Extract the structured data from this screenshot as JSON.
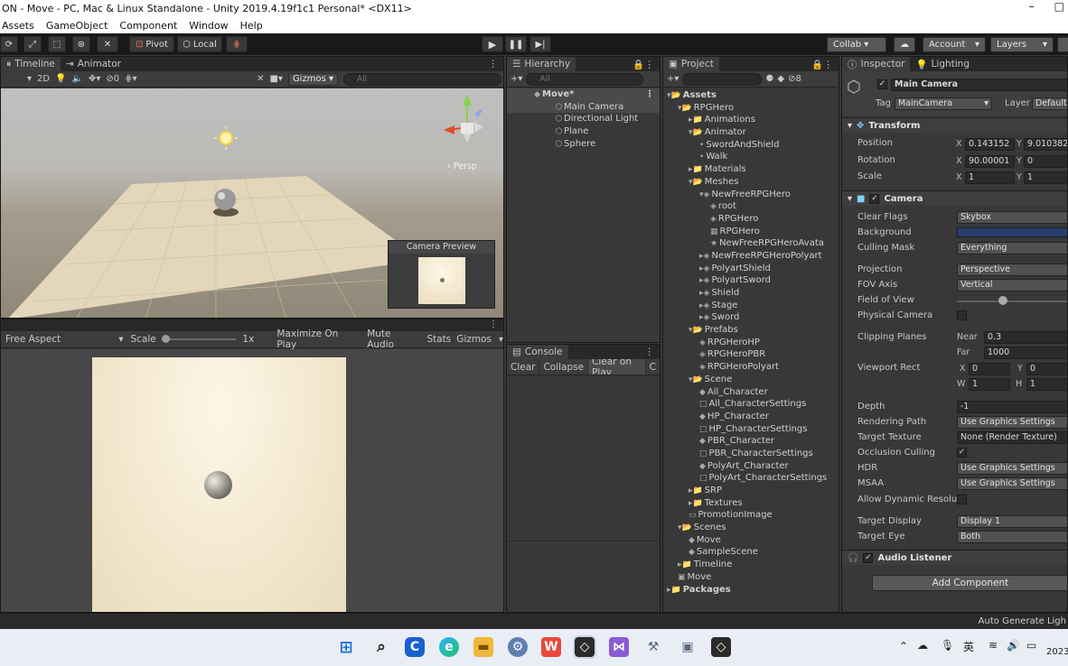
{
  "window": {
    "title": "ON - Move - PC, Mac & Linux Standalone - Unity 2019.4.19f1c1 Personal* <DX11>",
    "minimize": "–",
    "maximize": "□"
  },
  "menu": [
    "Assets",
    "GameObject",
    "Component",
    "Window",
    "Help"
  ],
  "toolbar": {
    "pivot": "Pivot",
    "local": "Local",
    "collab": "Collab ▾",
    "account": "Account",
    "layers": "Layers"
  },
  "scene": {
    "tabs": [
      "Timeline",
      "Animator"
    ],
    "mode2d": "2D",
    "gizmos": "Gizmos",
    "search_placeholder": "All",
    "persp": "‹ Persp",
    "fx_count": "0",
    "camera_preview_title": "Camera Preview"
  },
  "game": {
    "aspect": "Free Aspect",
    "scale_label": "Scale",
    "scale_value": "1x",
    "buttons": [
      "Maximize On Play",
      "Mute Audio",
      "Stats",
      "Gizmos"
    ]
  },
  "hierarchy": {
    "tab": "Hierarchy",
    "search_placeholder": "All",
    "scene": "Move*",
    "items": [
      "Main Camera",
      "Directional Light",
      "Plane",
      "Sphere"
    ]
  },
  "console": {
    "tab": "Console",
    "buttons": [
      "Clear",
      "Collapse",
      "Clear on Play",
      "C"
    ]
  },
  "project": {
    "tab": "Project",
    "badge": "8",
    "tree": [
      {
        "d": 0,
        "t": "Assets",
        "i": "▾📂"
      },
      {
        "d": 1,
        "t": "RPGHero",
        "i": "▾📂"
      },
      {
        "d": 2,
        "t": "Animations",
        "i": "▸📁"
      },
      {
        "d": 2,
        "t": "Animator",
        "i": "▾📂"
      },
      {
        "d": 3,
        "t": "SwordAndShield",
        "i": "•"
      },
      {
        "d": 3,
        "t": "Walk",
        "i": "•"
      },
      {
        "d": 2,
        "t": "Materials",
        "i": "▸📁"
      },
      {
        "d": 2,
        "t": "Meshes",
        "i": "▾📂"
      },
      {
        "d": 3,
        "t": "NewFreeRPGHero",
        "i": "▾◈"
      },
      {
        "d": 4,
        "t": "root",
        "i": "◈"
      },
      {
        "d": 4,
        "t": "RPGHero",
        "i": "◈"
      },
      {
        "d": 4,
        "t": "RPGHero",
        "i": "▦"
      },
      {
        "d": 4,
        "t": "NewFreeRPGHeroAvata",
        "i": "★"
      },
      {
        "d": 3,
        "t": "NewFreeRPGHeroPolyart",
        "i": "▸◈"
      },
      {
        "d": 3,
        "t": "PolyartShield",
        "i": "▸◈"
      },
      {
        "d": 3,
        "t": "PolyartSword",
        "i": "▸◈"
      },
      {
        "d": 3,
        "t": "Shield",
        "i": "▸◈"
      },
      {
        "d": 3,
        "t": "Stage",
        "i": "▸◈"
      },
      {
        "d": 3,
        "t": "Sword",
        "i": "▸◈"
      },
      {
        "d": 2,
        "t": "Prefabs",
        "i": "▾📂"
      },
      {
        "d": 3,
        "t": "RPGHeroHP",
        "i": "◈"
      },
      {
        "d": 3,
        "t": "RPGHeroPBR",
        "i": "◈"
      },
      {
        "d": 3,
        "t": "RPGHeroPolyart",
        "i": "◈"
      },
      {
        "d": 2,
        "t": "Scene",
        "i": "▾📂"
      },
      {
        "d": 3,
        "t": "All_Character",
        "i": "◆"
      },
      {
        "d": 3,
        "t": "All_CharacterSettings",
        "i": "□"
      },
      {
        "d": 3,
        "t": "HP_Character",
        "i": "◆"
      },
      {
        "d": 3,
        "t": "HP_CharacterSettings",
        "i": "□"
      },
      {
        "d": 3,
        "t": "PBR_Character",
        "i": "◆"
      },
      {
        "d": 3,
        "t": "PBR_CharacterSettings",
        "i": "□"
      },
      {
        "d": 3,
        "t": "PolyArt_Character",
        "i": "◆"
      },
      {
        "d": 3,
        "t": "PolyArt_CharacterSettings",
        "i": "□"
      },
      {
        "d": 2,
        "t": "SRP",
        "i": "▸📁"
      },
      {
        "d": 2,
        "t": "Textures",
        "i": "▸📁"
      },
      {
        "d": 2,
        "t": "PromotionImage",
        "i": "▭"
      },
      {
        "d": 1,
        "t": "Scenes",
        "i": "▾📂"
      },
      {
        "d": 2,
        "t": "Move",
        "i": "◆"
      },
      {
        "d": 2,
        "t": "SampleScene",
        "i": "◆"
      },
      {
        "d": 1,
        "t": "Timeline",
        "i": "▸📁"
      },
      {
        "d": 1,
        "t": "Move",
        "i": "▣"
      },
      {
        "d": 0,
        "t": "Packages",
        "i": "▸📁"
      }
    ]
  },
  "inspector": {
    "tabs": [
      "Inspector",
      "Lighting"
    ],
    "object_name": "Main Camera",
    "tag_label": "Tag",
    "tag": "MainCamera",
    "layer_label": "Layer",
    "layer": "Default",
    "transform": {
      "title": "Transform",
      "position_label": "Position",
      "pos_x": "0.143152",
      "pos_y": "9.010382",
      "rotation_label": "Rotation",
      "rot_x": "90.00001",
      "rot_y": "0",
      "scale_label": "Scale",
      "scale_x": "1",
      "scale_y": "1"
    },
    "camera": {
      "title": "Camera",
      "clear_flags_label": "Clear Flags",
      "clear_flags": "Skybox",
      "background_label": "Background",
      "background_color": "#27406e",
      "culling_mask_label": "Culling Mask",
      "culling_mask": "Everything",
      "projection_label": "Projection",
      "projection": "Perspective",
      "fov_axis_label": "FOV Axis",
      "fov_axis": "Vertical",
      "field_of_view_label": "Field of View",
      "field_of_view_fraction": 0.39,
      "physical_camera_label": "Physical Camera",
      "clipping_planes_label": "Clipping Planes",
      "near_label": "Near",
      "near": "0.3",
      "far_label": "Far",
      "far": "1000",
      "viewport_rect_label": "Viewport Rect",
      "vx": "0",
      "vy": "0",
      "vw": "1",
      "vh": "1",
      "depth_label": "Depth",
      "depth": "-1",
      "rendering_path_label": "Rendering Path",
      "rendering_path": "Use Graphics Settings",
      "target_texture_label": "Target Texture",
      "target_texture": "None (Render Texture)",
      "occlusion_culling_label": "Occlusion Culling",
      "hdr_label": "HDR",
      "hdr": "Use Graphics Settings",
      "msaa_label": "MSAA",
      "msaa": "Use Graphics Settings",
      "allow_dynamic_label": "Allow Dynamic Resolu",
      "target_display_label": "Target Display",
      "target_display": "Display 1",
      "target_eye_label": "Target Eye",
      "target_eye": "Both"
    },
    "audio_listener": "Audio Listener",
    "add_component": "Add Component"
  },
  "status": {
    "right": "Auto Generate Ligh"
  },
  "taskbar": {
    "lang": "英",
    "clock": "2023",
    "tray": "⌃"
  }
}
